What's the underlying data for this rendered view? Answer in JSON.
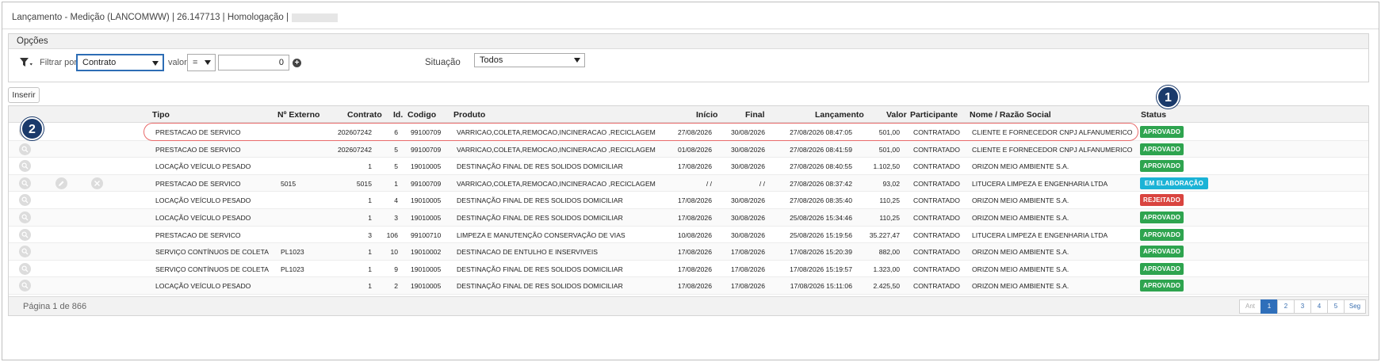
{
  "window": {
    "title": "Lançamento - Medição (LANCOMWW) | 26.147713 | Homologação |"
  },
  "options": {
    "header": "Opções",
    "filter_label": "Filtrar por",
    "filter_field": "Contrato",
    "value_label": "valor",
    "operator": "=",
    "value": "0",
    "situation_label": "Situação",
    "situation_value": "Todos"
  },
  "toolbar": {
    "insert_label": "Inserir"
  },
  "callouts": {
    "one": "1",
    "two": "2"
  },
  "table": {
    "columns": {
      "tipo": "Tipo",
      "externo": "Nº Externo",
      "contrato": "Contrato",
      "id": "Id.",
      "codigo": "Codigo",
      "produto": "Produto",
      "inicio": "Início",
      "final": "Final",
      "lancamento": "Lançamento",
      "valor": "Valor",
      "participante": "Participante",
      "nome": "Nome / Razão Social",
      "status": "Status"
    },
    "rows": [
      {
        "tipo": "PRESTACAO DE SERVICO",
        "externo": "",
        "contrato": "202607242",
        "id": "6",
        "codigo": "99100709",
        "produto": "VARRICAO,COLETA,REMOCAO,INCINERACAO ,RECICLAGEM",
        "inicio": "27/08/2026",
        "final": "30/08/2026",
        "lancamento": "27/08/2026 08:47:05",
        "valor": "501,00",
        "participante": "CONTRATADO",
        "nome": "CLIENTE E FORNECEDOR CNPJ ALFANUMERICO",
        "status": "APROVADO"
      },
      {
        "tipo": "PRESTACAO DE SERVICO",
        "externo": "",
        "contrato": "202607242",
        "id": "5",
        "codigo": "99100709",
        "produto": "VARRICAO,COLETA,REMOCAO,INCINERACAO ,RECICLAGEM",
        "inicio": "01/08/2026",
        "final": "30/08/2026",
        "lancamento": "27/08/2026 08:41:59",
        "valor": "501,00",
        "participante": "CONTRATADO",
        "nome": "CLIENTE E FORNECEDOR CNPJ ALFANUMERICO",
        "status": "APROVADO"
      },
      {
        "tipo": "LOCAÇÃO VEÍCULO PESADO",
        "externo": "",
        "contrato": "1",
        "id": "5",
        "codigo": "19010005",
        "produto": "DESTINAÇÃO FINAL DE RES SOLIDOS DOMICILIAR",
        "inicio": "17/08/2026",
        "final": "30/08/2026",
        "lancamento": "27/08/2026 08:40:55",
        "valor": "1.102,50",
        "participante": "CONTRATADO",
        "nome": "ORIZON MEIO AMBIENTE S.A.",
        "status": "APROVADO"
      },
      {
        "tipo": "PRESTACAO DE SERVICO",
        "externo": "5015",
        "contrato": "5015",
        "id": "1",
        "codigo": "99100709",
        "produto": "VARRICAO,COLETA,REMOCAO,INCINERACAO ,RECICLAGEM",
        "inicio": "/ /",
        "final": "/ /",
        "lancamento": "27/08/2026 08:37:42",
        "valor": "93,02",
        "participante": "CONTRATADO",
        "nome": "LITUCERA LIMPEZA E ENGENHARIA LTDA",
        "status": "EM ELABORAÇÃO"
      },
      {
        "tipo": "LOCAÇÃO VEÍCULO PESADO",
        "externo": "",
        "contrato": "1",
        "id": "4",
        "codigo": "19010005",
        "produto": "DESTINAÇÃO FINAL DE RES SOLIDOS DOMICILIAR",
        "inicio": "17/08/2026",
        "final": "30/08/2026",
        "lancamento": "27/08/2026 08:35:40",
        "valor": "110,25",
        "participante": "CONTRATADO",
        "nome": "ORIZON MEIO AMBIENTE S.A.",
        "status": "REJEITADO"
      },
      {
        "tipo": "LOCAÇÃO VEÍCULO PESADO",
        "externo": "",
        "contrato": "1",
        "id": "3",
        "codigo": "19010005",
        "produto": "DESTINAÇÃO FINAL DE RES SOLIDOS DOMICILIAR",
        "inicio": "17/08/2026",
        "final": "30/08/2026",
        "lancamento": "25/08/2026 15:34:46",
        "valor": "110,25",
        "participante": "CONTRATADO",
        "nome": "ORIZON MEIO AMBIENTE S.A.",
        "status": "APROVADO"
      },
      {
        "tipo": "PRESTACAO DE SERVICO",
        "externo": "",
        "contrato": "3",
        "id": "106",
        "codigo": "99100710",
        "produto": "LIMPEZA E MANUTENÇÃO CONSERVAÇÃO DE VIAS",
        "inicio": "10/08/2026",
        "final": "30/08/2026",
        "lancamento": "25/08/2026 15:19:56",
        "valor": "35.227,47",
        "participante": "CONTRATADO",
        "nome": "LITUCERA LIMPEZA E ENGENHARIA LTDA",
        "status": "APROVADO"
      },
      {
        "tipo": "SERVIÇO CONTÍNUOS DE COLETA",
        "externo": "PL1023",
        "contrato": "1",
        "id": "10",
        "codigo": "19010002",
        "produto": "DESTINACAO DE ENTULHO E INSERVIVEIS",
        "inicio": "17/08/2026",
        "final": "17/08/2026",
        "lancamento": "17/08/2026 15:20:39",
        "valor": "882,00",
        "participante": "CONTRATADO",
        "nome": "ORIZON MEIO AMBIENTE S.A.",
        "status": "APROVADO"
      },
      {
        "tipo": "SERVIÇO CONTÍNUOS DE COLETA",
        "externo": "PL1023",
        "contrato": "1",
        "id": "9",
        "codigo": "19010005",
        "produto": "DESTINAÇÃO FINAL DE RES SOLIDOS DOMICILIAR",
        "inicio": "17/08/2026",
        "final": "17/08/2026",
        "lancamento": "17/08/2026 15:19:57",
        "valor": "1.323,00",
        "participante": "CONTRATADO",
        "nome": "ORIZON MEIO AMBIENTE S.A.",
        "status": "APROVADO"
      },
      {
        "tipo": "LOCAÇÃO VEÍCULO PESADO",
        "externo": "",
        "contrato": "1",
        "id": "2",
        "codigo": "19010005",
        "produto": "DESTINAÇÃO FINAL DE RES SOLIDOS DOMICILIAR",
        "inicio": "17/08/2026",
        "final": "17/08/2026",
        "lancamento": "17/08/2026 15:11:06",
        "valor": "2.425,50",
        "participante": "CONTRATADO",
        "nome": "ORIZON MEIO AMBIENTE S.A.",
        "status": "APROVADO"
      }
    ]
  },
  "status_colors": {
    "APROVADO": "#2ea44f",
    "EM ELABORAÇÃO": "#1bb3d6",
    "REJEITADO": "#d9443f"
  },
  "footer": {
    "page_info": "Página 1 de 866",
    "pager": [
      "Ant",
      "1",
      "2",
      "3",
      "4",
      "5",
      "Seg"
    ]
  },
  "icons": {
    "filter": "funnel-icon",
    "add": "plus-circle-icon",
    "row_view": "magnifier-icon",
    "row_edit": "pencil-icon",
    "row_delete": "close-icon"
  }
}
